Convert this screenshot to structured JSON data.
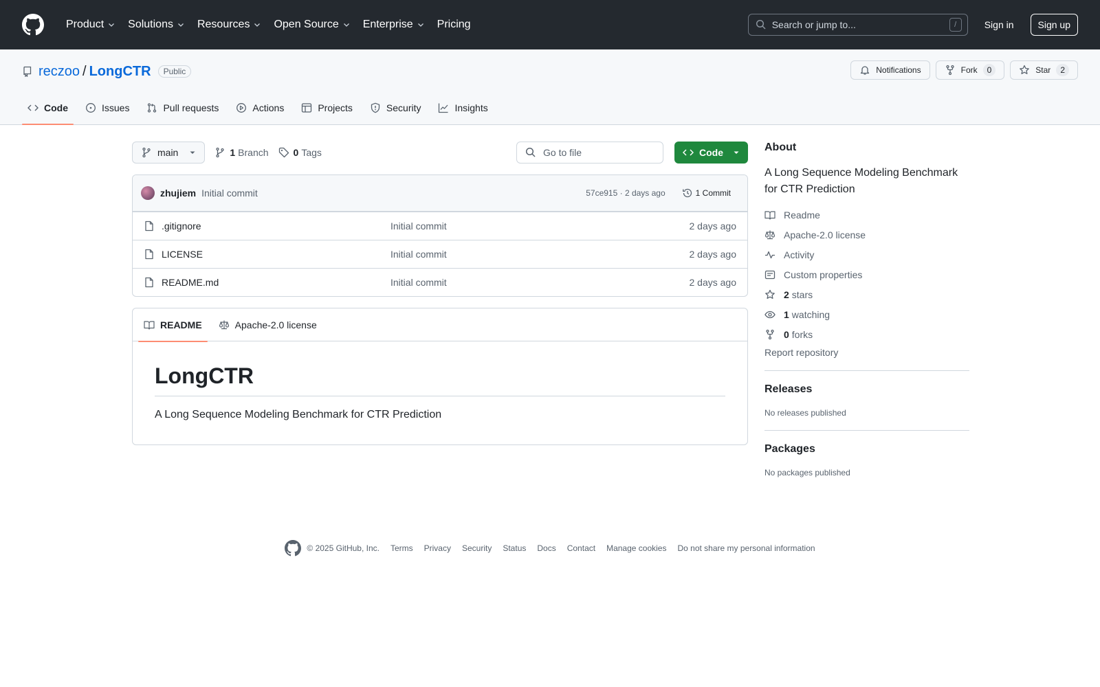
{
  "header": {
    "nav": [
      {
        "label": "Product",
        "has_menu": true
      },
      {
        "label": "Solutions",
        "has_menu": true
      },
      {
        "label": "Resources",
        "has_menu": true
      },
      {
        "label": "Open Source",
        "has_menu": true
      },
      {
        "label": "Enterprise",
        "has_menu": true
      },
      {
        "label": "Pricing",
        "has_menu": false
      }
    ],
    "search_placeholder": "Search or jump to...",
    "search_key": "/",
    "sign_in": "Sign in",
    "sign_up": "Sign up"
  },
  "repo": {
    "owner": "reczoo",
    "separator": "/",
    "name": "LongCTR",
    "visibility": "Public",
    "notifications_label": "Notifications",
    "fork_label": "Fork",
    "fork_count": "0",
    "star_label": "Star",
    "star_count": "2"
  },
  "tabs": [
    {
      "label": "Code",
      "icon": "code-icon",
      "selected": true
    },
    {
      "label": "Issues",
      "icon": "issue-icon"
    },
    {
      "label": "Pull requests",
      "icon": "pull-request-icon"
    },
    {
      "label": "Actions",
      "icon": "play-icon"
    },
    {
      "label": "Projects",
      "icon": "table-icon"
    },
    {
      "label": "Security",
      "icon": "shield-icon"
    },
    {
      "label": "Insights",
      "icon": "graph-icon"
    }
  ],
  "toolbar": {
    "branch": "main",
    "branch_count": "1",
    "branch_label": "Branch",
    "tag_count": "0",
    "tag_label": "Tags",
    "goto_placeholder": "Go to file",
    "code_button": "Code"
  },
  "latest_commit": {
    "author": "zhujiem",
    "message": "Initial commit",
    "meta": "57ce915 · 2 days ago",
    "commit_count": "1 Commit"
  },
  "files": [
    {
      "name": ".gitignore",
      "commit": "Initial commit",
      "age": "2 days ago"
    },
    {
      "name": "LICENSE",
      "commit": "Initial commit",
      "age": "2 days ago"
    },
    {
      "name": "README.md",
      "commit": "Initial commit",
      "age": "2 days ago"
    }
  ],
  "readme": {
    "tab_readme": "README",
    "tab_license": "Apache-2.0 license",
    "title": "LongCTR",
    "body": "A Long Sequence Modeling Benchmark for CTR Prediction"
  },
  "about": {
    "heading": "About",
    "description": "A Long Sequence Modeling Benchmark for CTR Prediction",
    "readme": "Readme",
    "license": "Apache-2.0 license",
    "activity": "Activity",
    "custom_properties": "Custom properties",
    "stars_count": "2",
    "stars_label": "stars",
    "watching_count": "1",
    "watching_label": "watching",
    "forks_count": "0",
    "forks_label": "forks",
    "report": "Report repository"
  },
  "releases": {
    "heading": "Releases",
    "note": "No releases published"
  },
  "packages": {
    "heading": "Packages",
    "note": "No packages published"
  },
  "footer": {
    "copyright": "© 2025 GitHub, Inc.",
    "links": [
      "Terms",
      "Privacy",
      "Security",
      "Status",
      "Docs",
      "Contact",
      "Manage cookies",
      "Do not share my personal information"
    ]
  },
  "colors": {
    "header_bg": "#24292f",
    "accent_green": "#1f883d",
    "link_blue": "#0969da",
    "tab_underline": "#fd8c73"
  }
}
